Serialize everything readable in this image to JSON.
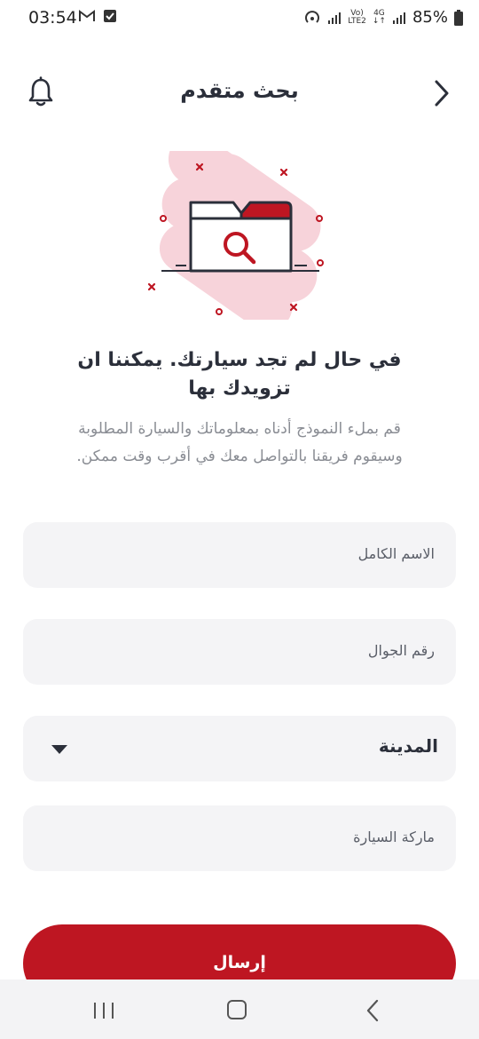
{
  "status_bar": {
    "time": "03:54",
    "network_top": "Vo)",
    "network_bottom": "LTE2",
    "data_type": "4G",
    "battery": "85%"
  },
  "header": {
    "title": "بحث متقدم"
  },
  "content": {
    "headline": "في حال لم تجد سيارتك. يمكننا ان تزويدك بها",
    "description": "قم بملء النموذج أدناه بمعلوماتك والسيارة المطلوبة وسيقوم فريقنا بالتواصل معك في أقرب وقت ممكن."
  },
  "form": {
    "full_name_placeholder": "الاسم الكامل",
    "mobile_placeholder": "رقم الجوال",
    "city_value": "المدينة",
    "car_brand_placeholder": "ماركة السيارة",
    "submit_label": "إرسال"
  },
  "colors": {
    "accent": "#be1622",
    "illustration_blob": "#f7d3da",
    "field_bg": "#f4f4f6"
  }
}
